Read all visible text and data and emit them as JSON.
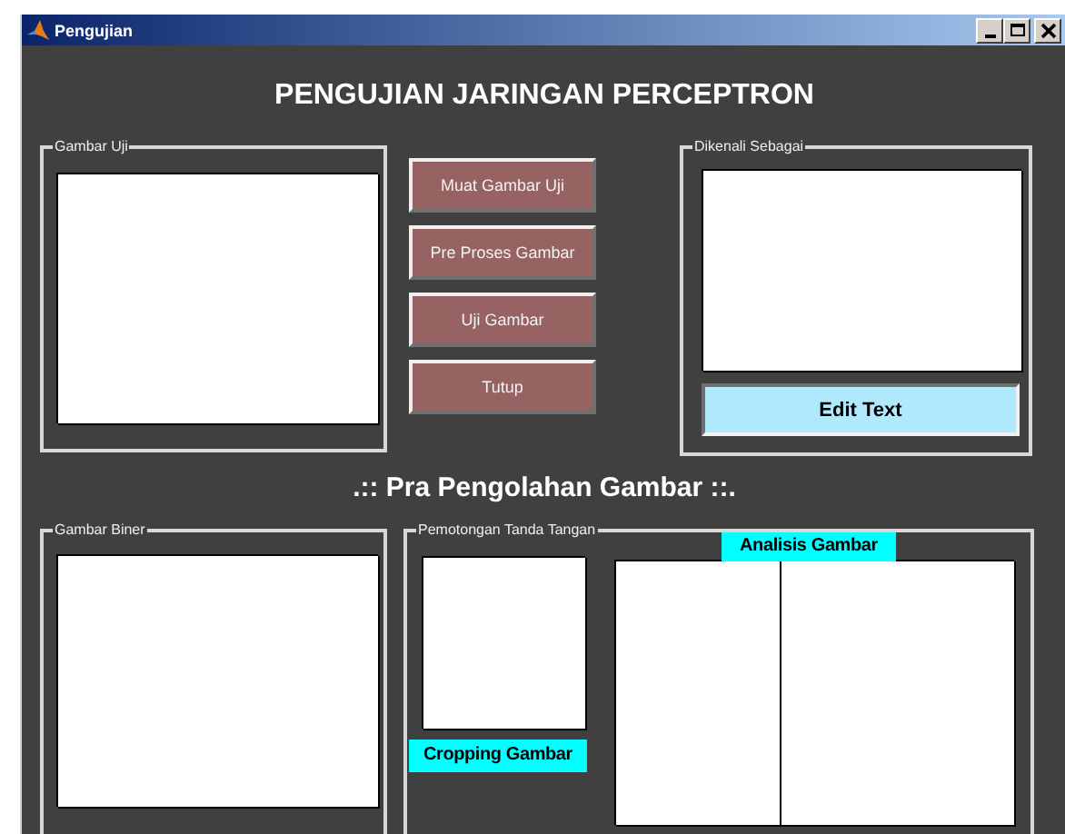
{
  "window": {
    "title": "Pengujian"
  },
  "heading": "PENGUJIAN JARINGAN PERCEPTRON",
  "test_panel": {
    "label": "Gambar Uji"
  },
  "buttons": [
    "Muat Gambar Uji",
    "Pre Proses Gambar",
    "Uji Gambar",
    "Tutup"
  ],
  "result_panel": {
    "label": "Dikenali Sebagai",
    "edit_text": "Edit Text"
  },
  "subheading": ".:: Pra Pengolahan Gambar ::.",
  "binary_panel": {
    "label": "Gambar Biner"
  },
  "crop_panel": {
    "label": "Pemotongan Tanda Tangan",
    "crop_label": "Cropping Gambar",
    "analysis_label": "Analisis Gambar"
  }
}
